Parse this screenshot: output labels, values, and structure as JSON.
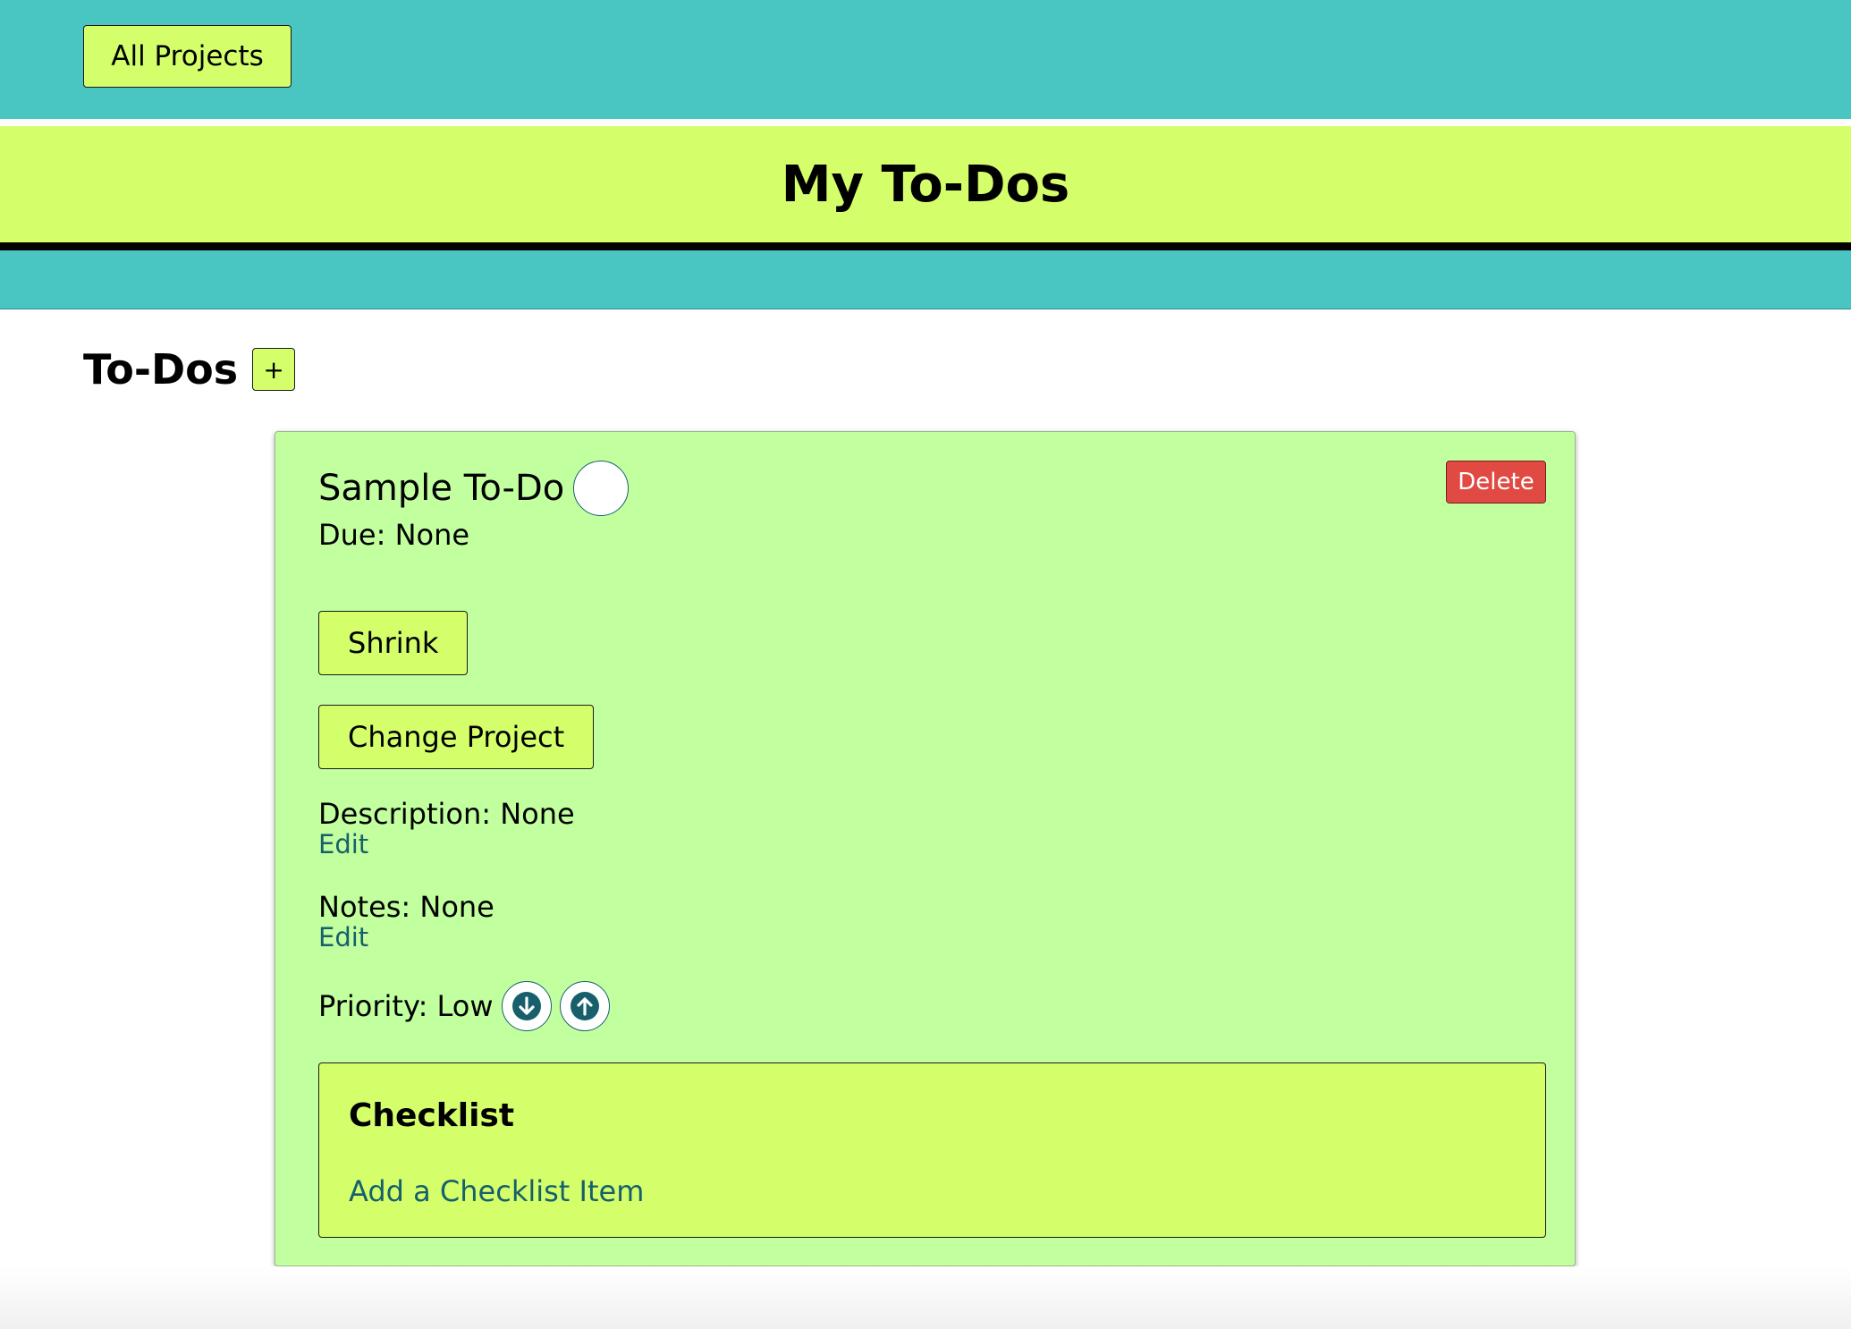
{
  "nav": {
    "all_projects_label": "All Projects"
  },
  "header": {
    "title": "My To-Dos"
  },
  "section": {
    "title": "To-Dos",
    "add_label": "+"
  },
  "todo": {
    "title": "Sample To-Do",
    "delete_label": "Delete",
    "due": "Due: None",
    "shrink_label": "Shrink",
    "change_project_label": "Change Project",
    "description": "Description: None",
    "description_edit": "Edit",
    "notes": "Notes: None",
    "notes_edit": "Edit",
    "priority": "Priority: Low",
    "checklist": {
      "title": "Checklist",
      "add_item_label": "Add a Checklist Item"
    }
  },
  "icons": {
    "priority_down": "arrow-down-circle-icon",
    "priority_up": "arrow-up-circle-icon"
  },
  "colors": {
    "teal": "#49c5c2",
    "lime": "#d4ff6b",
    "card_green": "#c1ff9f",
    "delete_red": "#e04a42",
    "link_teal": "#17606b"
  }
}
